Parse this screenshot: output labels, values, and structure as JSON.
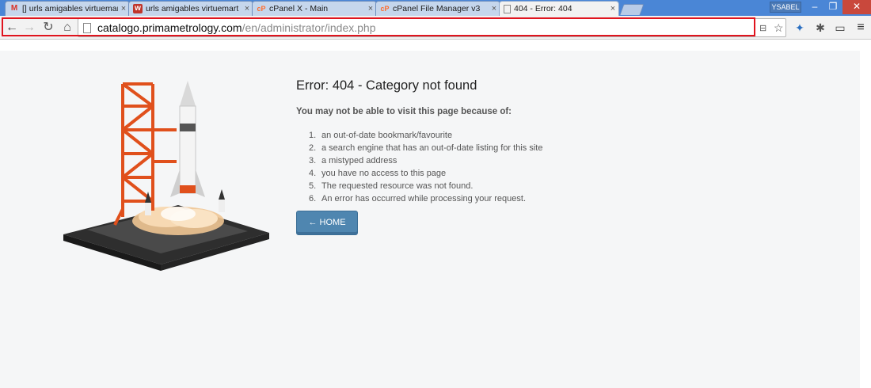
{
  "tabs": [
    {
      "title": "[] urls amigables virtuemar",
      "icon": "gmail-icon",
      "icon_glyph": "M",
      "icon_color": "#d93025",
      "active": false
    },
    {
      "title": "urls amigables virtuemart",
      "icon": "w-site-icon",
      "icon_glyph": "w",
      "icon_color": "#c0352b",
      "active": false
    },
    {
      "title": "cPanel X - Main",
      "icon": "cpanel-icon",
      "icon_glyph": "cP",
      "icon_color": "#ff6c2c",
      "active": false
    },
    {
      "title": "cPanel File Manager v3",
      "icon": "cpanel-icon",
      "icon_glyph": "cP",
      "icon_color": "#ff6c2c",
      "active": false
    },
    {
      "title": "404 - Error: 404",
      "icon": "page-icon",
      "icon_glyph": "",
      "icon_color": "#888888",
      "active": true
    }
  ],
  "window": {
    "user_badge": "YSABEL",
    "minimize": "–",
    "maximize": "❐",
    "close": "✕"
  },
  "toolbar": {
    "back": "←",
    "forward": "→",
    "reload": "↻",
    "home": "⌂",
    "url_host": "catalogo.primametrology.com",
    "url_path": "/en/administrator/index.php",
    "translate": "⊟",
    "star": "☆",
    "ext1": "✦",
    "ext2": "✱",
    "ext3": "▭",
    "menu": "≡"
  },
  "page": {
    "error_title": "Error: 404 - Category not found",
    "reason_title": "You may not be able to visit this page because of:",
    "reasons": [
      {
        "num": "1.",
        "text": "an out-of-date bookmark/favourite"
      },
      {
        "num": "2.",
        "text": "a search engine that has an out-of-date listing for this site"
      },
      {
        "num": "3.",
        "text": "a mistyped address"
      },
      {
        "num": "4.",
        "text": "you have no access to this page"
      },
      {
        "num": "5.",
        "text": "The requested resource was not found."
      },
      {
        "num": "6.",
        "text": "An error has occurred while processing your request."
      }
    ],
    "home_button": "← HOME"
  },
  "colors": {
    "accent": "#4f86b0",
    "highlight": "#e0141e",
    "chrome_frame": "#4a86d6"
  }
}
